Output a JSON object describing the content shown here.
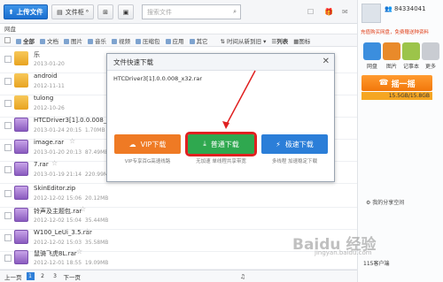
{
  "toolbar": {
    "upload_label": "上传文件",
    "cabinet_label": "文件柜 ⁶",
    "search_placeholder": "搜索文件"
  },
  "breadcrumb": {
    "root": "网盘"
  },
  "categories": {
    "all": "全部",
    "doc": "文档",
    "image": "图片",
    "music": "音乐",
    "video": "视频",
    "archive": "压缩包",
    "app": "应用",
    "other": "其它",
    "sort": "时间从新到旧",
    "view_list": "列表",
    "view_icon": "图标"
  },
  "files": [
    {
      "name": "乐",
      "date": "2013-01-20",
      "size": "",
      "type": "folder"
    },
    {
      "name": "android",
      "date": "2012-11-11",
      "size": "",
      "type": "folder"
    },
    {
      "name": "tulong",
      "date": "2012-10-26",
      "size": "",
      "type": "folder"
    },
    {
      "name": "HTCDriver3[1].0.0.008_x32.rar",
      "date": "2013-01-24 20:15",
      "size": "1.70MB",
      "type": "rar"
    },
    {
      "name": "image.rar",
      "date": "2013-01-20 20:13",
      "size": "87.49MB",
      "type": "rar"
    },
    {
      "name": "7.rar",
      "date": "2013-01-19 21:14",
      "size": "220.99MB",
      "type": "rar"
    },
    {
      "name": "SkinEditor.zip",
      "date": "2012-12-02 15:06",
      "size": "20.12MB",
      "type": "rar"
    },
    {
      "name": "铃声及主题包.rar",
      "date": "2012-12-02 15:04",
      "size": "35.44MB",
      "type": "rar"
    },
    {
      "name": "W100_LeUi_3.5.rar",
      "date": "2012-12-02 15:03",
      "size": "35.58MB",
      "type": "rar"
    },
    {
      "name": "鼠骑飞虎8L.rar",
      "date": "2012-12-01 18:55",
      "size": "19.09MB",
      "type": "rar"
    }
  ],
  "pager": {
    "prev": "上一页",
    "p1": "1",
    "p2": "2",
    "p3": "3",
    "next": "下一页"
  },
  "user": {
    "id": "84334041",
    "notice": "充值购买网盘，免费赠送种资料",
    "tiles": [
      "网盘",
      "图片",
      "记事本",
      "更多"
    ],
    "ding": "摇一摇",
    "quota": "15.5GB/15.8GB",
    "share": "我的分享空间",
    "client": "115客户端"
  },
  "dialog": {
    "title": "文件快速下载",
    "file": "HTCDriver3[1].0.0.008_x32.rar",
    "vip_label": "VIP下载",
    "vip_sub": "VIP专享百G高速线路",
    "normal_label": "普通下载",
    "normal_sub": "无加速 单线程共享带宽",
    "fast_label": "极速下载",
    "fast_sub": "多线程 加速稳定下载"
  },
  "watermark": {
    "main": "Baidu 经验",
    "sub": "jingyan.baidu.com"
  },
  "colors": {
    "vip": "#ef7a24",
    "normal": "#2fa84f",
    "fast": "#2b7ed8",
    "highlight": "#e02020"
  }
}
